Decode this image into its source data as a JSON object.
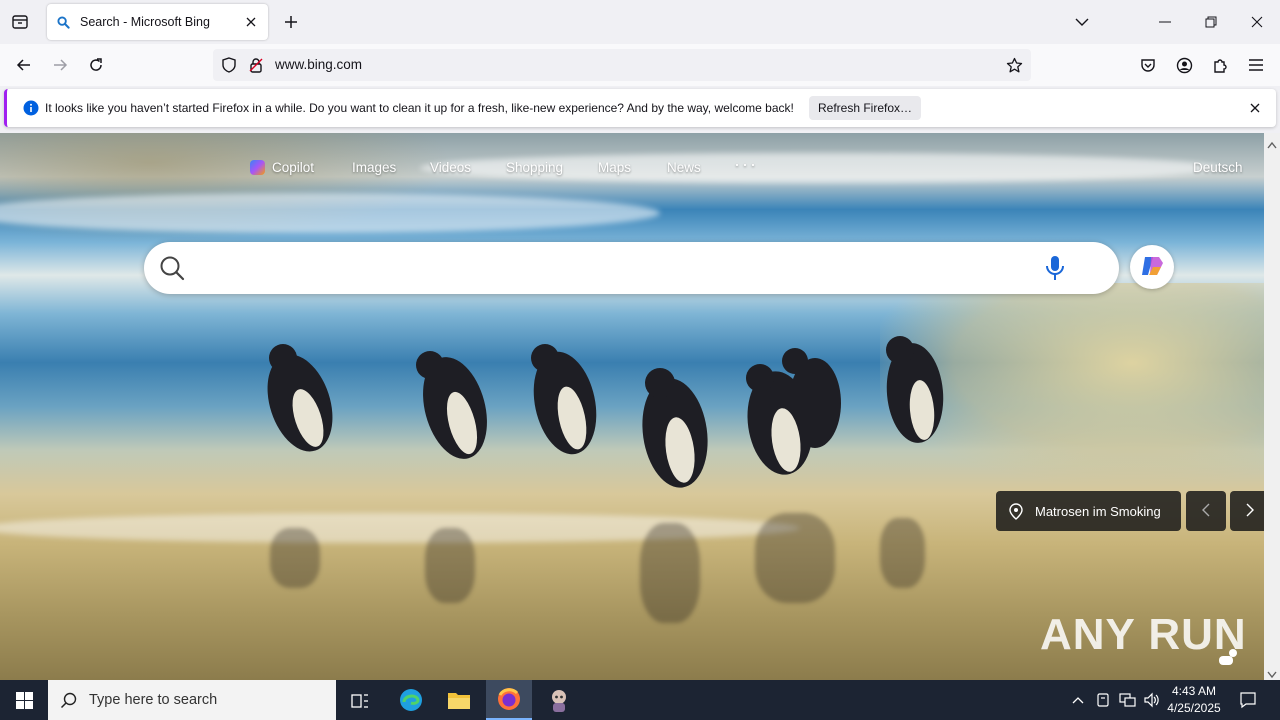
{
  "browser": {
    "tab": {
      "title": "Search - Microsoft Bing"
    },
    "url": "www.bing.com"
  },
  "notification": {
    "message": "It looks like you haven’t started Firefox in a while. Do you want to clean it up for a fresh, like-new experience? And by the way, welcome back!",
    "button_label": "Refresh Firefox…"
  },
  "bing": {
    "nav": {
      "copilot": "Copilot",
      "images": "Images",
      "videos": "Videos",
      "shopping": "Shopping",
      "maps": "Maps",
      "news": "News",
      "more": "···",
      "language": "Deutsch"
    },
    "image_caption": "Matrosen im Smoking"
  },
  "watermark": {
    "text": "ANY RUN"
  },
  "taskbar": {
    "search_placeholder": "Type here to search",
    "time": "4:43 AM",
    "date": "4/25/2025"
  },
  "icons": {
    "tab_list": "tab-list-icon",
    "new_tab": "plus-icon",
    "back": "back-arrow-icon",
    "forward": "forward-arrow-icon",
    "reload": "reload-icon",
    "shield": "shield-icon",
    "lock": "lock-icon",
    "bookmark": "star-icon",
    "pocket": "pocket-icon",
    "account": "account-icon",
    "extensions": "puzzle-icon",
    "menu": "hamburger-icon"
  },
  "colors": {
    "notification_accent": "#a020f0",
    "info_blue": "#0060df",
    "taskbar": "#1c2433"
  }
}
